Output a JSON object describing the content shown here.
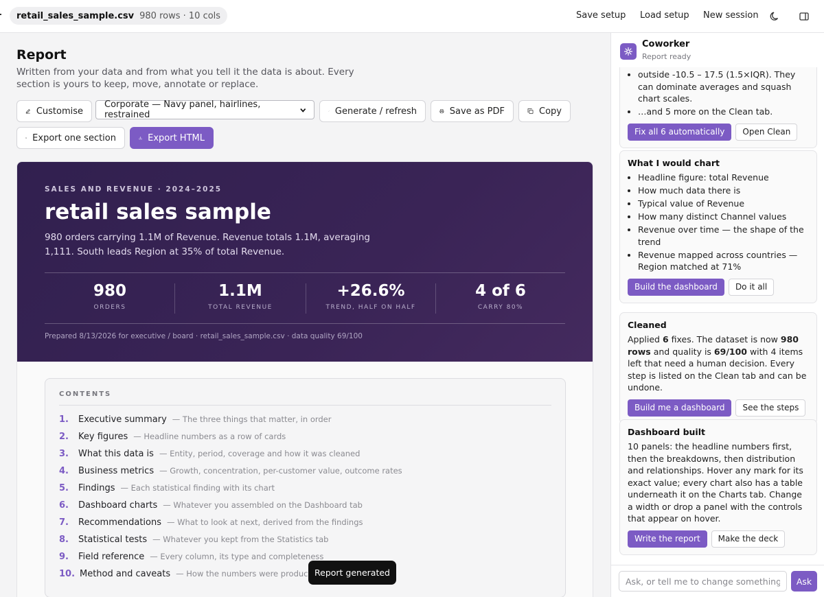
{
  "topbar": {
    "file_name": "retail_sales_sample.csv",
    "file_meta": "980 rows · 10 cols",
    "save_setup": "Save setup",
    "load_setup": "Load setup",
    "new_session": "New session",
    "theme_icon": "moon-icon",
    "panel_icon": "sidebar-toggle-icon"
  },
  "page": {
    "title": "Report",
    "description": "Written from your data and from what you tell it the data is about. Every section is yours to keep, move, annotate or replace."
  },
  "toolbar": {
    "customise": "Customise",
    "theme_select": "Corporate — Navy panel, hairlines, restrained",
    "generate": "Generate / refresh",
    "save_pdf": "Save as PDF",
    "copy": "Copy",
    "export_section": "Export one section",
    "export_html": "Export HTML"
  },
  "hero": {
    "kicker": "SALES AND REVENUE · 2024–2025",
    "title": "retail sales sample",
    "subtitle": "980 orders carrying 1.1M of Revenue. Revenue totals 1.1M, averaging 1,111. South leads Region at 35% of total Revenue.",
    "stats": [
      {
        "value": "980",
        "label": "ORDERS"
      },
      {
        "value": "1.1M",
        "label": "TOTAL REVENUE"
      },
      {
        "value": "+26.6%",
        "label": "TREND, HALF ON HALF"
      },
      {
        "value": "4 of 6",
        "label": "CARRY 80%"
      }
    ],
    "footer": "Prepared 8/13/2026 for executive / board · retail_sales_sample.csv · data quality 69/100"
  },
  "contents": {
    "heading": "CONTENTS",
    "items": [
      {
        "num": "1.",
        "label": "Executive summary",
        "desc": "— The three things that matter, in order"
      },
      {
        "num": "2.",
        "label": "Key figures",
        "desc": "— Headline numbers as a row of cards"
      },
      {
        "num": "3.",
        "label": "What this data is",
        "desc": "— Entity, period, coverage and how it was cleaned"
      },
      {
        "num": "4.",
        "label": "Business metrics",
        "desc": "— Growth, concentration, per-customer value, outcome rates"
      },
      {
        "num": "5.",
        "label": "Findings",
        "desc": "— Each statistical finding with its chart"
      },
      {
        "num": "6.",
        "label": "Dashboard charts",
        "desc": "— Whatever you assembled on the Dashboard tab"
      },
      {
        "num": "7.",
        "label": "Recommendations",
        "desc": "— What to look at next, derived from the findings"
      },
      {
        "num": "8.",
        "label": "Statistical tests",
        "desc": "— Whatever you kept from the Statistics tab"
      },
      {
        "num": "9.",
        "label": "Field reference",
        "desc": "— Every column, its type and completeness"
      },
      {
        "num": "10.",
        "label": "Method and caveats",
        "desc": "— How the numbers were produced and"
      }
    ]
  },
  "toast": "Report generated",
  "coworker": {
    "name": "Coworker",
    "status": "Report ready",
    "card0": {
      "partial_text": "outside -10.5 – 17.5 (1.5×IQR). They can dominate averages and squash chart scales.",
      "more": "…and 5 more on the Clean tab.",
      "primary": "Fix all 6 automatically",
      "secondary": "Open Clean"
    },
    "card1": {
      "title": "What I would chart",
      "items": [
        "Headline figure: total Revenue",
        "How much data there is",
        "Typical value of Revenue",
        "How many distinct Channel values",
        "Revenue over time — the shape of the trend",
        "Revenue mapped across countries — Region matched at 71%"
      ],
      "primary": "Build the dashboard",
      "secondary": "Do it all"
    },
    "card2": {
      "title": "Cleaned",
      "t1": "Applied ",
      "b1": "6",
      "t2": " fixes. The dataset is now ",
      "b2": "980 rows",
      "t3": " and quality is ",
      "b3": "69/100",
      "t4": " with 4 items left that need a human decision. Every step is listed on the Clean tab and can be undone.",
      "primary": "Build me a dashboard",
      "secondary": "See the steps"
    },
    "card3": {
      "title": "Dashboard built",
      "text": "10 panels: the headline numbers first, then the breakdowns, then distribution and relationships. Hover any mark for its exact value; every chart also has a table underneath it on the Charts tab. Change a width or drop a panel with the controls that appear on hover.",
      "primary": "Write the report",
      "secondary": "Make the deck"
    },
    "input_placeholder": "Ask, or tell me to change something…",
    "ask": "Ask"
  },
  "colors": {
    "accent": "#7c5bc4",
    "hero_bg": "#33214f"
  }
}
